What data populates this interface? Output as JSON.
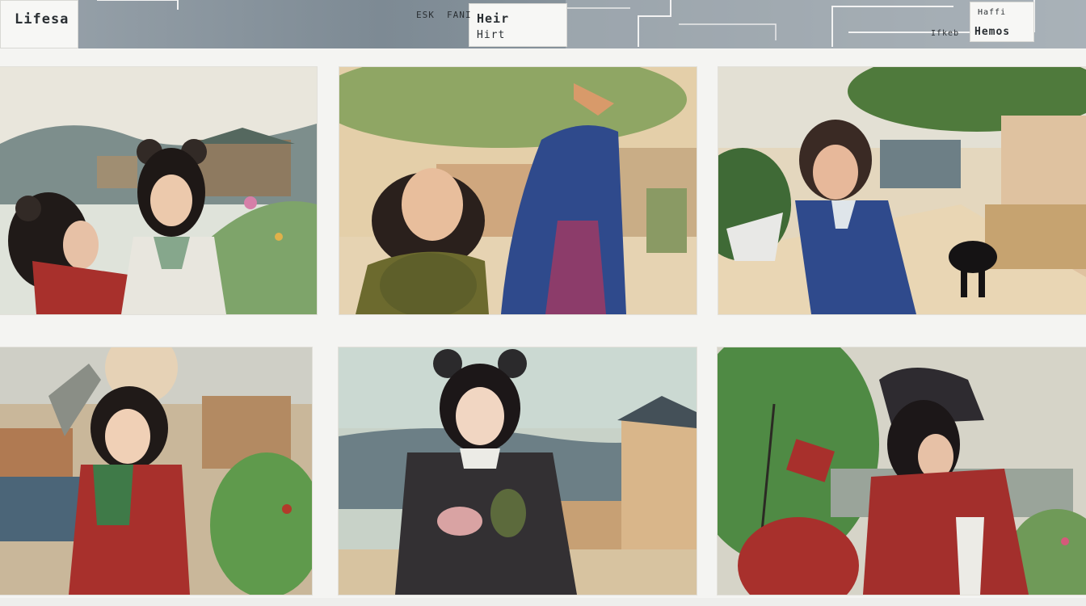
{
  "header": {
    "scribbles": [
      "Lifesa",
      "ESK",
      "FANI",
      "Heir",
      "Hirt",
      "Haffi",
      "Ifkeb",
      "Hemos"
    ]
  },
  "panels": [
    {
      "name": "panel-two-girls-hill-village"
    },
    {
      "name": "panel-girl-green-robe-blue-figure"
    },
    {
      "name": "panel-girl-blue-robe-street-dog"
    },
    {
      "name": "panel-girl-red-robe-rooftops"
    },
    {
      "name": "panel-girl-hood-holding-bird"
    },
    {
      "name": "panel-girl-red-cloak-bowing"
    }
  ],
  "colors": {
    "paper": "#f4f4f2",
    "strip": "#8b969e",
    "red_robe": "#a8302c",
    "blue_robe": "#2f4a8c",
    "green_robe": "#6c6a2e",
    "dark_robe": "#333033"
  }
}
